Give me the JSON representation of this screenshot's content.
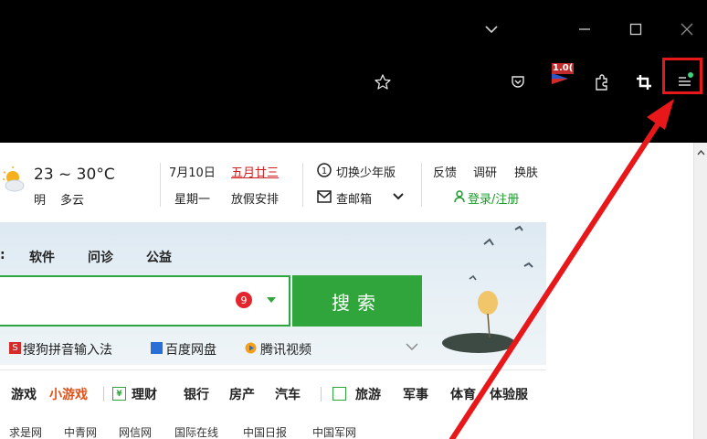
{
  "titlebar": {
    "chevron_icon": "chevron-down-icon",
    "minimize_icon": "minimize-icon",
    "maximize_icon": "maximize-icon",
    "close_icon": "close-icon"
  },
  "toolbar": {
    "badge_text": "1.0(",
    "icons": [
      "star-icon",
      "pocket-icon",
      "flag-extension-icon",
      "extensions-icon",
      "crop-icon",
      "menu-icon"
    ],
    "highlight_color": "#e8171a"
  },
  "weather": {
    "temp": "23 ~ 30°C",
    "day": "明",
    "condition": "多云"
  },
  "info": {
    "date": "7月10日",
    "lunar": "五月廿三",
    "weekday": "星期一",
    "holiday": "放假安排",
    "youth_mode": "切换少年版",
    "mail": "查邮箱",
    "feedback": "反馈",
    "survey": "调研",
    "skin": "换肤",
    "login": "登录/注册"
  },
  "search": {
    "tabs": [
      "软件",
      "问诊",
      "公益"
    ],
    "badge": "9",
    "button": "搜索",
    "quick_links": [
      "搜狗拼音输入法",
      "百度网盘",
      "腾讯视频"
    ]
  },
  "nav": {
    "items": [
      "游戏",
      "小游戏",
      "理财",
      "银行",
      "房产",
      "汽车",
      "旅游",
      "军事",
      "体育",
      "体验服"
    ]
  },
  "links": [
    "求是网",
    "中青网",
    "网信网",
    "国际在线",
    "中国日报",
    "中国军网"
  ],
  "colors": {
    "accent_green": "#2fa53b",
    "accent_red": "#d11e1e"
  }
}
